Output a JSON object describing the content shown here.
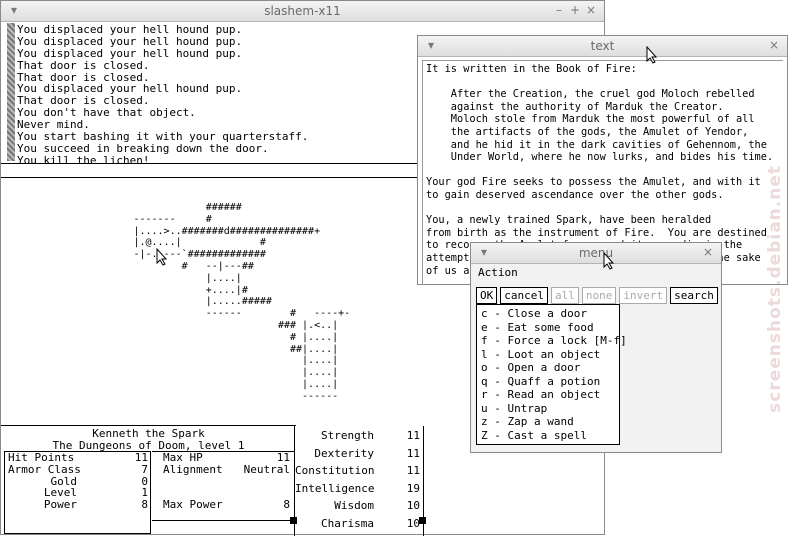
{
  "main_window": {
    "title": "slashem-x11",
    "buttons": {
      "minimize": "–",
      "maximize": "+",
      "close": "×"
    },
    "messages": [
      "You displaced your hell hound pup.",
      "You displaced your hell hound pup.",
      "You displaced your hell hound pup.",
      "That door is closed.",
      "That door is closed.",
      "You displaced your hell hound pup.",
      "That door is closed.",
      "You don't have that object.",
      "Never mind.",
      "You start bashing it with your quarterstaff.",
      "You succeed in breaking down the door.",
      "You kill the lichen!"
    ],
    "map": [
      "                                  ######",
      "                      -------     #",
      "                      |....>..#######d##############+",
      "                      |.@....|             #",
      "                      -|-.----`#############",
      "                              #   --|---##",
      "                                  |....|",
      "                                  +....|#",
      "                                  |.....#####",
      "                                  ------        #   ----+-",
      "                                              ### |.<..|",
      "                                                # |....|",
      "                                                ##|....|",
      "                                                  |....|",
      "                                                  |....|",
      "                                                  |....|",
      "                                                  ------"
    ],
    "status": {
      "name_line": "Kenneth the Spark",
      "level_line": "The Dungeons of Doom, level 1",
      "left": [
        {
          "label": "Hit Points",
          "value": "11"
        },
        {
          "label": "Armor Class",
          "value": "7"
        },
        {
          "label": "Gold",
          "value": "0"
        },
        {
          "label": "Level",
          "value": "1"
        },
        {
          "label": "Power",
          "value": "8"
        }
      ],
      "middle": [
        {
          "label": "Max HP",
          "value": "11"
        },
        {
          "label": "Alignment",
          "value": "Neutral"
        },
        {
          "label": "Max Power",
          "value": "8"
        }
      ],
      "attributes": [
        {
          "label": "Strength",
          "value": "11"
        },
        {
          "label": "Dexterity",
          "value": "11"
        },
        {
          "label": "Constitution",
          "value": "11"
        },
        {
          "label": "Intelligence",
          "value": "19"
        },
        {
          "label": "Wisdom",
          "value": "10"
        },
        {
          "label": "Charisma",
          "value": "10"
        }
      ]
    }
  },
  "text_window": {
    "title": "text",
    "close": "×",
    "lines": [
      "It is written in the Book of Fire:",
      "",
      "    After the Creation, the cruel god Moloch rebelled",
      "    against the authority of Marduk the Creator.",
      "    Moloch stole from Marduk the most powerful of all",
      "    the artifacts of the gods, the Amulet of Yendor,",
      "    and he hid it in the dark cavities of Gehennom, the",
      "    Under World, where he now lurks, and bides his time.",
      "",
      "Your god Fire seeks to possess the Amulet, and with it",
      "to gain deserved ascendance over the other gods.",
      "",
      "You, a newly trained Spark, have been heralded",
      "from birth as the instrument of Fire.  You are destined",
      "to recover the Amulet for your deity, or die in the",
      "attempt.  Your hour of destiny has come.  For the sake",
      "of us all:  Go bravely with Fire!"
    ]
  },
  "menu_window": {
    "title": "menu",
    "close": "×",
    "heading": "Action",
    "buttons": [
      {
        "label": "OK",
        "enabled": true
      },
      {
        "label": "cancel",
        "enabled": true
      },
      {
        "label": "all",
        "enabled": false
      },
      {
        "label": "none",
        "enabled": false
      },
      {
        "label": "invert",
        "enabled": false
      },
      {
        "label": "search",
        "enabled": true
      }
    ],
    "items": [
      "c - Close a door",
      "e - Eat some food",
      "f - Force a lock [M-f]",
      "l - Loot an object",
      "o - Open a door",
      "q - Quaff a potion",
      "r - Read an object",
      "u - Untrap",
      "z - Zap a wand",
      "Z - Cast a spell"
    ]
  },
  "watermark": "screenshots.debian.net"
}
